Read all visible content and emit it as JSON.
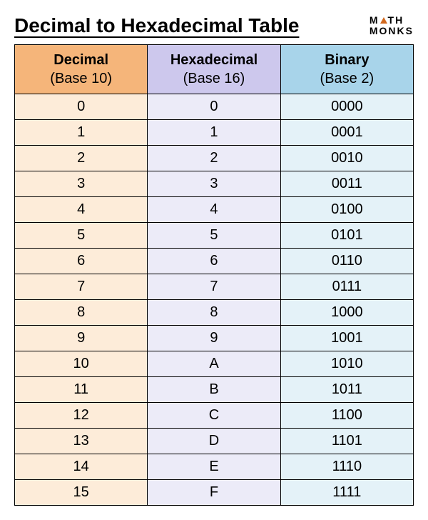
{
  "title": "Decimal to Hexadecimal Table",
  "logo": {
    "top": "M",
    "tri": "▲",
    "after": "TH",
    "bottom": "MONKS"
  },
  "columns": [
    {
      "name": "Decimal",
      "base": "(Base 10)"
    },
    {
      "name": "Hexadecimal",
      "base": "(Base 16)"
    },
    {
      "name": "Binary",
      "base": "(Base 2)"
    }
  ],
  "chart_data": {
    "type": "table",
    "columns": [
      "Decimal",
      "Hexadecimal",
      "Binary"
    ],
    "rows": [
      [
        "0",
        "0",
        "0000"
      ],
      [
        "1",
        "1",
        "0001"
      ],
      [
        "2",
        "2",
        "0010"
      ],
      [
        "3",
        "3",
        "0011"
      ],
      [
        "4",
        "4",
        "0100"
      ],
      [
        "5",
        "5",
        "0101"
      ],
      [
        "6",
        "6",
        "0110"
      ],
      [
        "7",
        "7",
        "0111"
      ],
      [
        "8",
        "8",
        "1000"
      ],
      [
        "9",
        "9",
        "1001"
      ],
      [
        "10",
        "A",
        "1010"
      ],
      [
        "11",
        "B",
        "1011"
      ],
      [
        "12",
        "C",
        "1100"
      ],
      [
        "13",
        "D",
        "1101"
      ],
      [
        "14",
        "E",
        "1110"
      ],
      [
        "15",
        "F",
        "1111"
      ]
    ]
  }
}
